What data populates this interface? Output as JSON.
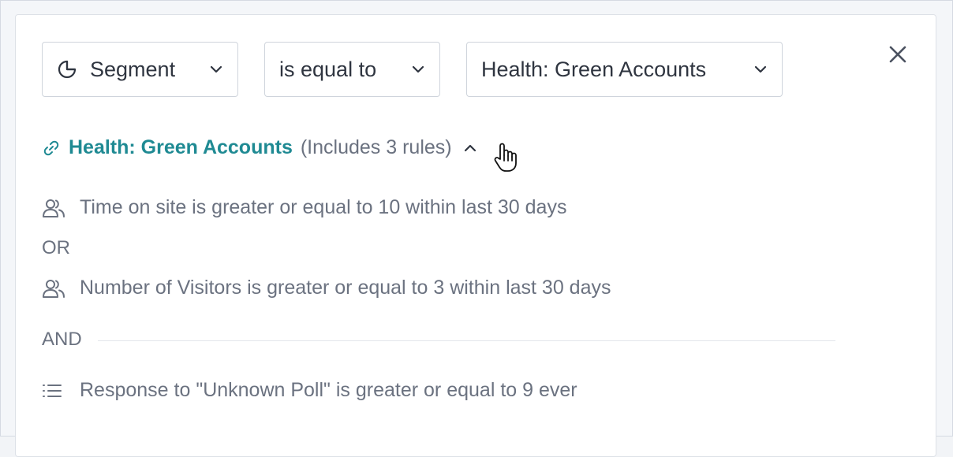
{
  "filter": {
    "segment_label": "Segment",
    "operator_label": "is equal to",
    "value_label": "Health: Green Accounts"
  },
  "linked_segment": {
    "name": "Health: Green Accounts",
    "note": "(Includes 3 rules)"
  },
  "rules": [
    {
      "icon": "users-icon",
      "text": "Time on site is greater or equal to 10 within last 30 days"
    },
    {
      "icon": "users-icon",
      "text": "Number of Visitors is greater or equal to 3 within last 30 days"
    },
    {
      "icon": "list-icon",
      "text": "Response to \"Unknown Poll\" is greater or equal to 9 ever"
    }
  ],
  "operators": {
    "or": "OR",
    "and": "AND"
  },
  "colors": {
    "accent": "#1f8a93",
    "text": "#2f3540",
    "muted": "#6b7280",
    "border": "#cfd4dc"
  }
}
